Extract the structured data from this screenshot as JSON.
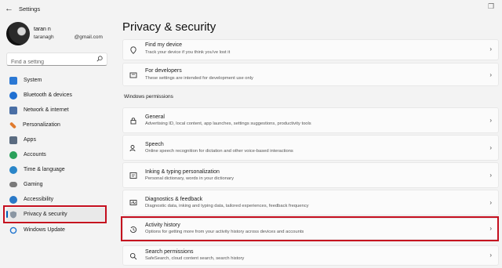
{
  "window": {
    "title": "Settings",
    "back_glyph": "←",
    "restore_glyph": "❐"
  },
  "user": {
    "name": "taran n",
    "email_prefix": "taranagh",
    "email_domain": "@gmail.com"
  },
  "search": {
    "placeholder": "Find a setting"
  },
  "sidebar": {
    "items": [
      {
        "label": "System",
        "icon": "system-icon",
        "color": "#2b78d4"
      },
      {
        "label": "Bluetooth & devices",
        "icon": "bluetooth-icon",
        "color": "#1f6fd1"
      },
      {
        "label": "Network & internet",
        "icon": "network-icon",
        "color": "#4a6fa5"
      },
      {
        "label": "Personalization",
        "icon": "brush-icon",
        "color": "#e07a2d"
      },
      {
        "label": "Apps",
        "icon": "apps-icon",
        "color": "#5a6b80"
      },
      {
        "label": "Accounts",
        "icon": "accounts-icon",
        "color": "#2aa05a"
      },
      {
        "label": "Time & language",
        "icon": "globe-icon",
        "color": "#2a86c9"
      },
      {
        "label": "Gaming",
        "icon": "gaming-icon",
        "color": "#7a7a7a"
      },
      {
        "label": "Accessibility",
        "icon": "accessibility-icon",
        "color": "#2a79c8"
      },
      {
        "label": "Privacy & security",
        "icon": "shield-icon",
        "color": "#6b7785",
        "active": true
      },
      {
        "label": "Windows Update",
        "icon": "windows-update-icon",
        "color": "#1f74cf"
      }
    ]
  },
  "main": {
    "title": "Privacy & security",
    "cards_top": [
      {
        "title": "Find my device",
        "subtitle": "Track your device if you think you've lost it",
        "icon": "location-icon"
      },
      {
        "title": "For developers",
        "subtitle": "These settings are intended for development use only",
        "icon": "developer-icon"
      }
    ],
    "section_label": "Windows permissions",
    "cards": [
      {
        "title": "General",
        "subtitle": "Advertising ID, local content, app launches, settings suggestions, productivity tools",
        "icon": "lock-icon"
      },
      {
        "title": "Speech",
        "subtitle": "Online speech recognition for dictation and other voice-based interactions",
        "icon": "speech-icon"
      },
      {
        "title": "Inking & typing personalization",
        "subtitle": "Personal dictionary, words in your dictionary",
        "icon": "inking-icon"
      },
      {
        "title": "Diagnostics & feedback",
        "subtitle": "Diagnostic data, inking and typing data, tailored experiences, feedback frequency",
        "icon": "diagnostics-icon"
      },
      {
        "title": "Activity history",
        "subtitle": "Options for getting more from your activity history across devices and accounts",
        "icon": "history-icon"
      },
      {
        "title": "Search permissions",
        "subtitle": "SafeSearch, cloud content search, search history",
        "icon": "search-permissions-icon"
      }
    ],
    "chevron": "›"
  }
}
